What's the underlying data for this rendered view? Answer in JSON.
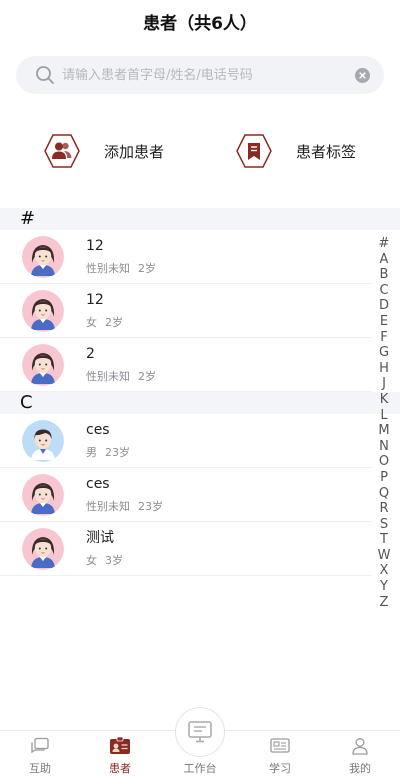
{
  "header": {
    "title": "患者（共6人）"
  },
  "search": {
    "placeholder": "请输入患者首字母/姓名/电话号码"
  },
  "actions": [
    {
      "label": "添加患者",
      "icon": "add-patient-icon"
    },
    {
      "label": "患者标签",
      "icon": "tag-bookmark-icon"
    }
  ],
  "sections": [
    {
      "letter": "#",
      "patients": [
        {
          "name": "12",
          "gender": "性别未知",
          "age": "2岁",
          "avatar": "female"
        },
        {
          "name": "12",
          "gender": "女",
          "age": "2岁",
          "avatar": "female"
        },
        {
          "name": "2",
          "gender": "性别未知",
          "age": "2岁",
          "avatar": "female"
        }
      ]
    },
    {
      "letter": "C",
      "patients": [
        {
          "name": "ces",
          "gender": "男",
          "age": "23岁",
          "avatar": "male"
        },
        {
          "name": "ces",
          "gender": "性别未知",
          "age": "23岁",
          "avatar": "female"
        },
        {
          "name": "测试",
          "gender": "女",
          "age": "3岁",
          "avatar": "female"
        }
      ]
    }
  ],
  "index_letters": [
    "#",
    "A",
    "B",
    "C",
    "D",
    "E",
    "F",
    "G",
    "H",
    "J",
    "K",
    "L",
    "M",
    "N",
    "O",
    "P",
    "Q",
    "R",
    "S",
    "T",
    "W",
    "X",
    "Y",
    "Z"
  ],
  "tabs": [
    {
      "label": "互助",
      "icon": "chat-icon",
      "active": false
    },
    {
      "label": "患者",
      "icon": "patient-card-icon",
      "active": true
    },
    {
      "label": "工作台",
      "icon": "workbench-icon",
      "active": false
    },
    {
      "label": "学习",
      "icon": "study-icon",
      "active": false
    },
    {
      "label": "我的",
      "icon": "profile-icon",
      "active": false
    }
  ],
  "colors": {
    "accent": "#8a2a22",
    "section_bg": "#f4f5f8",
    "search_bg": "#f2f3f6"
  }
}
